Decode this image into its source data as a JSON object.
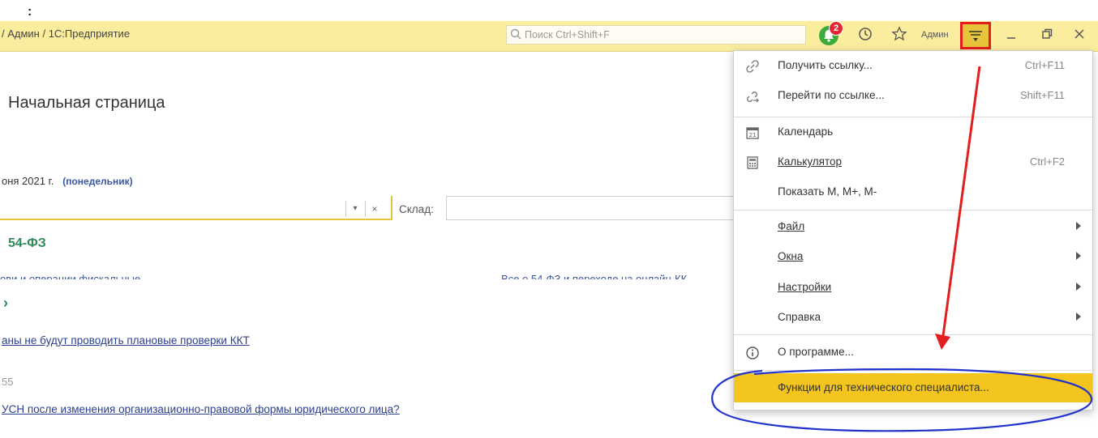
{
  "stray_text": ":",
  "titlebar": {
    "title": "/ Админ / 1С:Предприятие",
    "search_placeholder": "Поиск Ctrl+Shift+F",
    "notification_count": "2",
    "user": "Админ"
  },
  "page": {
    "title": "Начальная страница",
    "date_text": "оня 2021 г.",
    "date_day": "(понедельник)",
    "warehouse_label": "Склад:",
    "section_title": "54-ФЗ",
    "cut_text_left": "ови и операции фискальные ......",
    "cut_text_right": "Все о 54-ФЗ и переходе на онлайн-КК",
    "news_link_1": "аны не будут проводить плановые проверки ККТ",
    "news_number": "55",
    "news_link_2": "УСН после изменения организационно-правовой формы юридического лица?"
  },
  "menu": {
    "items": [
      {
        "label": "Получить ссылку...",
        "shortcut": "Ctrl+F11",
        "icon": "link-icon"
      },
      {
        "label": "Перейти по ссылке...",
        "shortcut": "Shift+F11",
        "icon": "go-link-icon"
      },
      {
        "label": "Календарь",
        "shortcut": "",
        "icon": "calendar-icon"
      },
      {
        "label": "Калькулятор",
        "shortcut": "Ctrl+F2",
        "icon": "calculator-icon"
      },
      {
        "label": "Показать M, M+, M-",
        "shortcut": "",
        "icon": ""
      },
      {
        "label": "Файл",
        "submenu": true
      },
      {
        "label": "Окна",
        "submenu": true
      },
      {
        "label": "Настройки",
        "submenu": true
      },
      {
        "label": "Справка",
        "submenu": true
      },
      {
        "label": "О программе...",
        "icon": "info-icon"
      },
      {
        "label": "Функции для технического специалиста..."
      }
    ]
  },
  "colors": {
    "titlebar": "#fbed9e",
    "accent": "#f3c51e",
    "link": "#2a3f8f",
    "section": "#2e8b57",
    "annotation_red": "#e21e1e",
    "annotation_blue": "#2233cc"
  }
}
